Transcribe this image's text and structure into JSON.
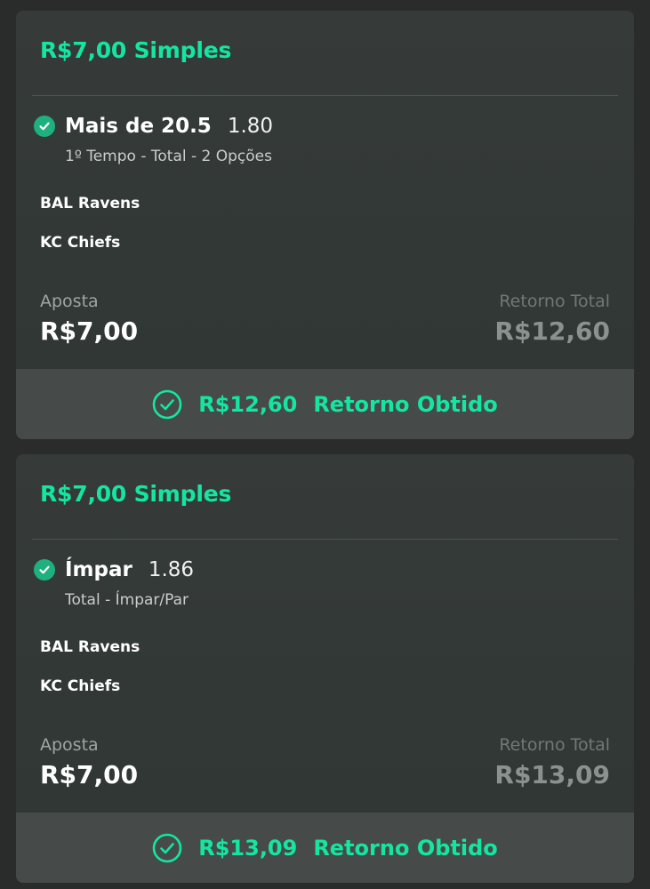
{
  "bets": [
    {
      "header": "R$7,00 Simples",
      "selection": "Mais de 20.5",
      "odds": "1.80",
      "market": "1º Tempo - Total - 2 Opções",
      "teams": [
        "BAL Ravens",
        "KC Chiefs"
      ],
      "stake_label": "Aposta",
      "stake_value": "R$7,00",
      "return_label": "Retorno Total",
      "return_value": "R$12,60",
      "footer_amount": "R$12,60",
      "footer_text": "Retorno Obtido"
    },
    {
      "header": "R$7,00 Simples",
      "selection": "Ímpar",
      "odds": "1.86",
      "market": "Total - Ímpar/Par",
      "teams": [
        "BAL Ravens",
        "KC Chiefs"
      ],
      "stake_label": "Aposta",
      "stake_value": "R$7,00",
      "return_label": "Retorno Total",
      "return_value": "R$13,09",
      "footer_amount": "R$13,09",
      "footer_text": "Retorno Obtido"
    }
  ],
  "colors": {
    "accent": "#14e6a2",
    "check": "#1fb07f",
    "card": "#333937",
    "footer": "#464b49",
    "background": "#2a2b2b"
  },
  "icons": {
    "selection_status": "check-circle-filled-icon",
    "footer_status": "check-circle-outline-icon"
  }
}
